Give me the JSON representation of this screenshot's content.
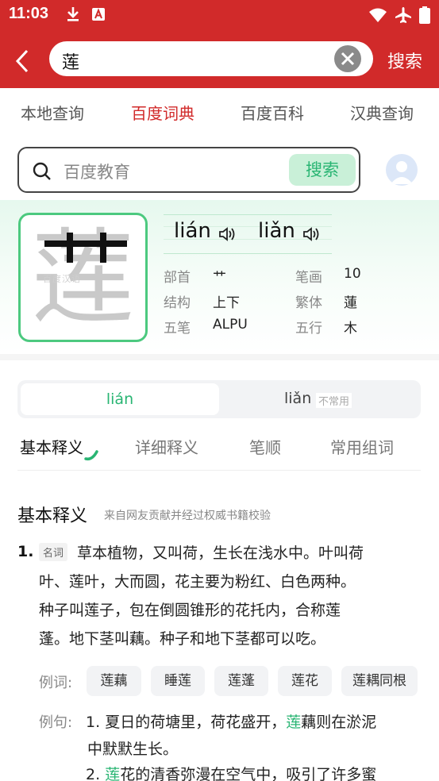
{
  "status_bar": {
    "time": "11:03",
    "icons": [
      "download-icon",
      "app-icon",
      "wifi-icon",
      "airplane-icon",
      "battery-icon"
    ]
  },
  "header": {
    "query": "莲",
    "search_label": "搜索",
    "accent": "#d12a2a"
  },
  "tabs": [
    {
      "label": "本地查询",
      "active": false
    },
    {
      "label": "百度词典",
      "active": true
    },
    {
      "label": "百度百科",
      "active": false
    },
    {
      "label": "汉典查询",
      "active": false
    }
  ],
  "edu_search": {
    "placeholder": "百度教育",
    "button": "搜索",
    "accent": "#29b573"
  },
  "character": {
    "glyph": "莲",
    "watermark": "百度汉语",
    "pinyin": [
      "lián",
      "liǎn"
    ],
    "info": [
      {
        "key": "部首",
        "value": "艹"
      },
      {
        "key": "笔画",
        "value": "10"
      },
      {
        "key": "结构",
        "value": "上下"
      },
      {
        "key": "繁体",
        "value": "蓮"
      },
      {
        "key": "五笔",
        "value": "ALPU"
      },
      {
        "key": "五行",
        "value": "木"
      }
    ]
  },
  "reading_toggle": {
    "active": "lián",
    "other": "liǎn",
    "other_tag": "不常用"
  },
  "sub_tabs": [
    "基本释义",
    "详细释义",
    "笔顺",
    "常用组词"
  ],
  "definition": {
    "title": "基本释义",
    "source": "来自网友贡献并经过权威书籍校验",
    "number": "1.",
    "pos": "名词",
    "lines": [
      "草本植物，又叫荷，生长在浅水中。叶叫荷",
      "叶、莲叶，大而圆，花主要为粉红、白色两种。",
      "种子叫莲子，包在倒圆锥形的花托内，合称莲",
      "蓬。地下茎叫藕。种子和地下茎都可以吃。"
    ],
    "example_words_label": "例词:",
    "example_words": [
      "莲藕",
      "睡莲",
      "莲蓬",
      "莲花",
      "莲耦同根"
    ],
    "example_sentences_label": "例句:",
    "sentences": [
      {
        "num": "1.",
        "pre": "夏日的荷塘里，荷花盛开，",
        "hl": "莲",
        "post": "藕则在淤泥",
        "cont": "中默默生长。"
      },
      {
        "num": "2.",
        "pre": "",
        "hl": "莲",
        "post": "花的清香弥漫在空气中，吸引了许多蜜",
        "cont": ""
      }
    ]
  }
}
